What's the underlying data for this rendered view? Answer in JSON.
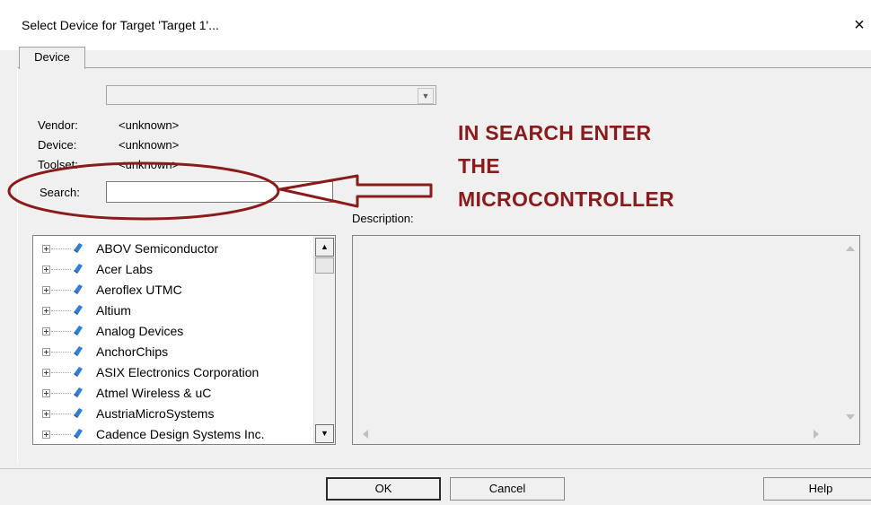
{
  "window": {
    "title": "Select Device for Target 'Target 1'...",
    "close_symbol": "×"
  },
  "tabs": [
    {
      "label": "Device"
    }
  ],
  "fields": {
    "vendor_label": "Vendor:",
    "vendor_value": "<unknown>",
    "device_label": "Device:",
    "device_value": "<unknown>",
    "toolset_label": "Toolset:",
    "toolset_value": "<unknown>",
    "search_label": "Search:",
    "search_value": ""
  },
  "annotation": {
    "lines": [
      "IN SEARCH ENTER",
      "THE",
      "MICROCONTROLLER"
    ],
    "color": "#8b1a1a"
  },
  "description": {
    "label": "Description:",
    "text": ""
  },
  "device_tree": {
    "items": [
      {
        "label": "ABOV Semiconductor"
      },
      {
        "label": "Acer Labs"
      },
      {
        "label": "Aeroflex UTMC"
      },
      {
        "label": "Altium"
      },
      {
        "label": "Analog Devices"
      },
      {
        "label": "AnchorChips"
      },
      {
        "label": "ASIX Electronics Corporation"
      },
      {
        "label": "Atmel Wireless & uC"
      },
      {
        "label": "AustriaMicroSystems"
      },
      {
        "label": "Cadence Design Systems Inc."
      }
    ]
  },
  "buttons": {
    "ok": "OK",
    "cancel": "Cancel",
    "help": "Help"
  }
}
